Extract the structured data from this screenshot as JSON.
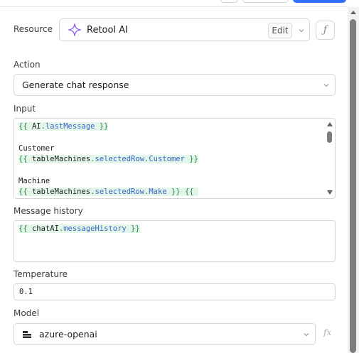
{
  "resource": {
    "label": "Resource",
    "name": "Retool AI",
    "edit_label": "Edit",
    "fx_symbol": "ƒ",
    "icon": "sparkle-icon",
    "icon_color": "#8b5cf6"
  },
  "action": {
    "label": "Action",
    "value": "Generate chat response"
  },
  "input": {
    "label": "Input",
    "line1": {
      "open": "{{ ",
      "obj": "AI",
      "dot": ".",
      "prop": "lastMessage",
      "close": " }}"
    },
    "line3": "Customer",
    "line4": {
      "open": "{{ ",
      "obj": "tableMachines",
      "dot1": ".",
      "prop1": "selectedRow",
      "dot2": ".",
      "prop2": "Customer",
      "close": " }}"
    },
    "line6": "Machine",
    "line7": {
      "open": "{{ ",
      "obj": "tableMachines",
      "dot1": ".",
      "prop1": "selectedRow",
      "dot2": ".",
      "prop2": "Make",
      "close": " }}",
      "trail": " {{ "
    }
  },
  "message_history": {
    "label": "Message history",
    "line1": {
      "open": "{{ ",
      "obj": "chatAI",
      "dot": ".",
      "prop": "messageHistory",
      "close": " }}"
    }
  },
  "temperature": {
    "label": "Temperature",
    "value": "0.1"
  },
  "model": {
    "label": "Model",
    "value": "azure-openai",
    "fx_symbol": "fx",
    "icon": "database-icon"
  },
  "colors": {
    "accent": "#3170f9",
    "template_bg": "#e3f6e9",
    "template_brace": "#2a8a4a",
    "template_prop": "#3a66c9"
  }
}
